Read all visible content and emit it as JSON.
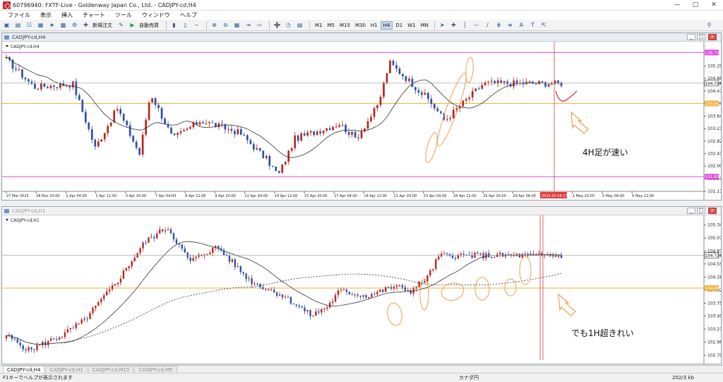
{
  "window": {
    "title": "60796940: FXTF-Live - Goldenway Japan Co., Ltd. - CADJPY-cd,H4"
  },
  "menu": [
    "ファイル",
    "表示",
    "挿入",
    "チャート",
    "ツール",
    "ウィンドウ",
    "ヘルプ"
  ],
  "toolbar": {
    "new_order": "新規注文",
    "auto_trade": "自動売買",
    "timeframes": [
      "M1",
      "M5",
      "M15",
      "M30",
      "H1",
      "H4",
      "D1",
      "W1",
      "MN"
    ],
    "active_timeframe": "H4"
  },
  "chart_h4": {
    "window_title": "CADJPY-cd,H4",
    "label": "CADJPY-cd,H4",
    "price_ticks": [
      "105.290",
      "104.880",
      "104.470",
      "104.060",
      "103.640",
      "103.230",
      "102.820",
      "102.410",
      "102.000",
      "101.590",
      "101.170"
    ],
    "current_price": "104.724",
    "level_high": "105.733",
    "level_mid": "104.060",
    "level_low": "101.652",
    "time_ticks": [
      "27 Mar 2025",
      "28 Mar 20:00",
      "1 Apr 04:00",
      "2 Apr 12:00",
      "3 Apr 20:00",
      "7 Apr 04:00",
      "8 Apr 12:00",
      "9 Apr 20:00",
      "11 Apr 04:00",
      "14 Apr 12:00",
      "15 Apr 20:00",
      "17 Apr 04:00",
      "18 Apr 12:00",
      "21 Apr 20:00",
      "23 Apr 04:00",
      "24 Apr 12:00",
      "25 Apr 20:00",
      "29 Apr 04:00",
      "30 Apr 12:00",
      "1 May 20:00",
      "5 May 04:00",
      "6 May 12:00"
    ],
    "cursor_time": "2025.05.08 17:00",
    "annotation": "4H足が速い"
  },
  "chart_h1": {
    "window_title": "CADJPY-cd,H1",
    "label": "CADJPY-cd,H1",
    "price_ticks": [
      "105.340",
      "105.075",
      "104.810",
      "104.550",
      "104.285",
      "104.020",
      "103.755",
      "103.495",
      "103.230",
      "102.965",
      "102.700"
    ],
    "current_price": "104.724",
    "level_mid": "104.060",
    "annotation": "でも1H超きれい"
  },
  "tabs": [
    "CADJPY-cd,H4",
    "CADJPY-cd,H1",
    "CADJPY-cd,M15",
    "CADJPY-cd,M5"
  ],
  "status": {
    "help": "F1キーでヘルプが表示されます",
    "profile": "カナダ円",
    "traffic": "202/3 kb"
  },
  "colors": {
    "bull": "#b5261e",
    "bear": "#2f4fa8",
    "ma": "#333333",
    "level_orange": "#f2b33d",
    "level_magenta": "#e14be1",
    "annotation_orange": "#f0a050",
    "cursor_red": "#e23a3a"
  }
}
